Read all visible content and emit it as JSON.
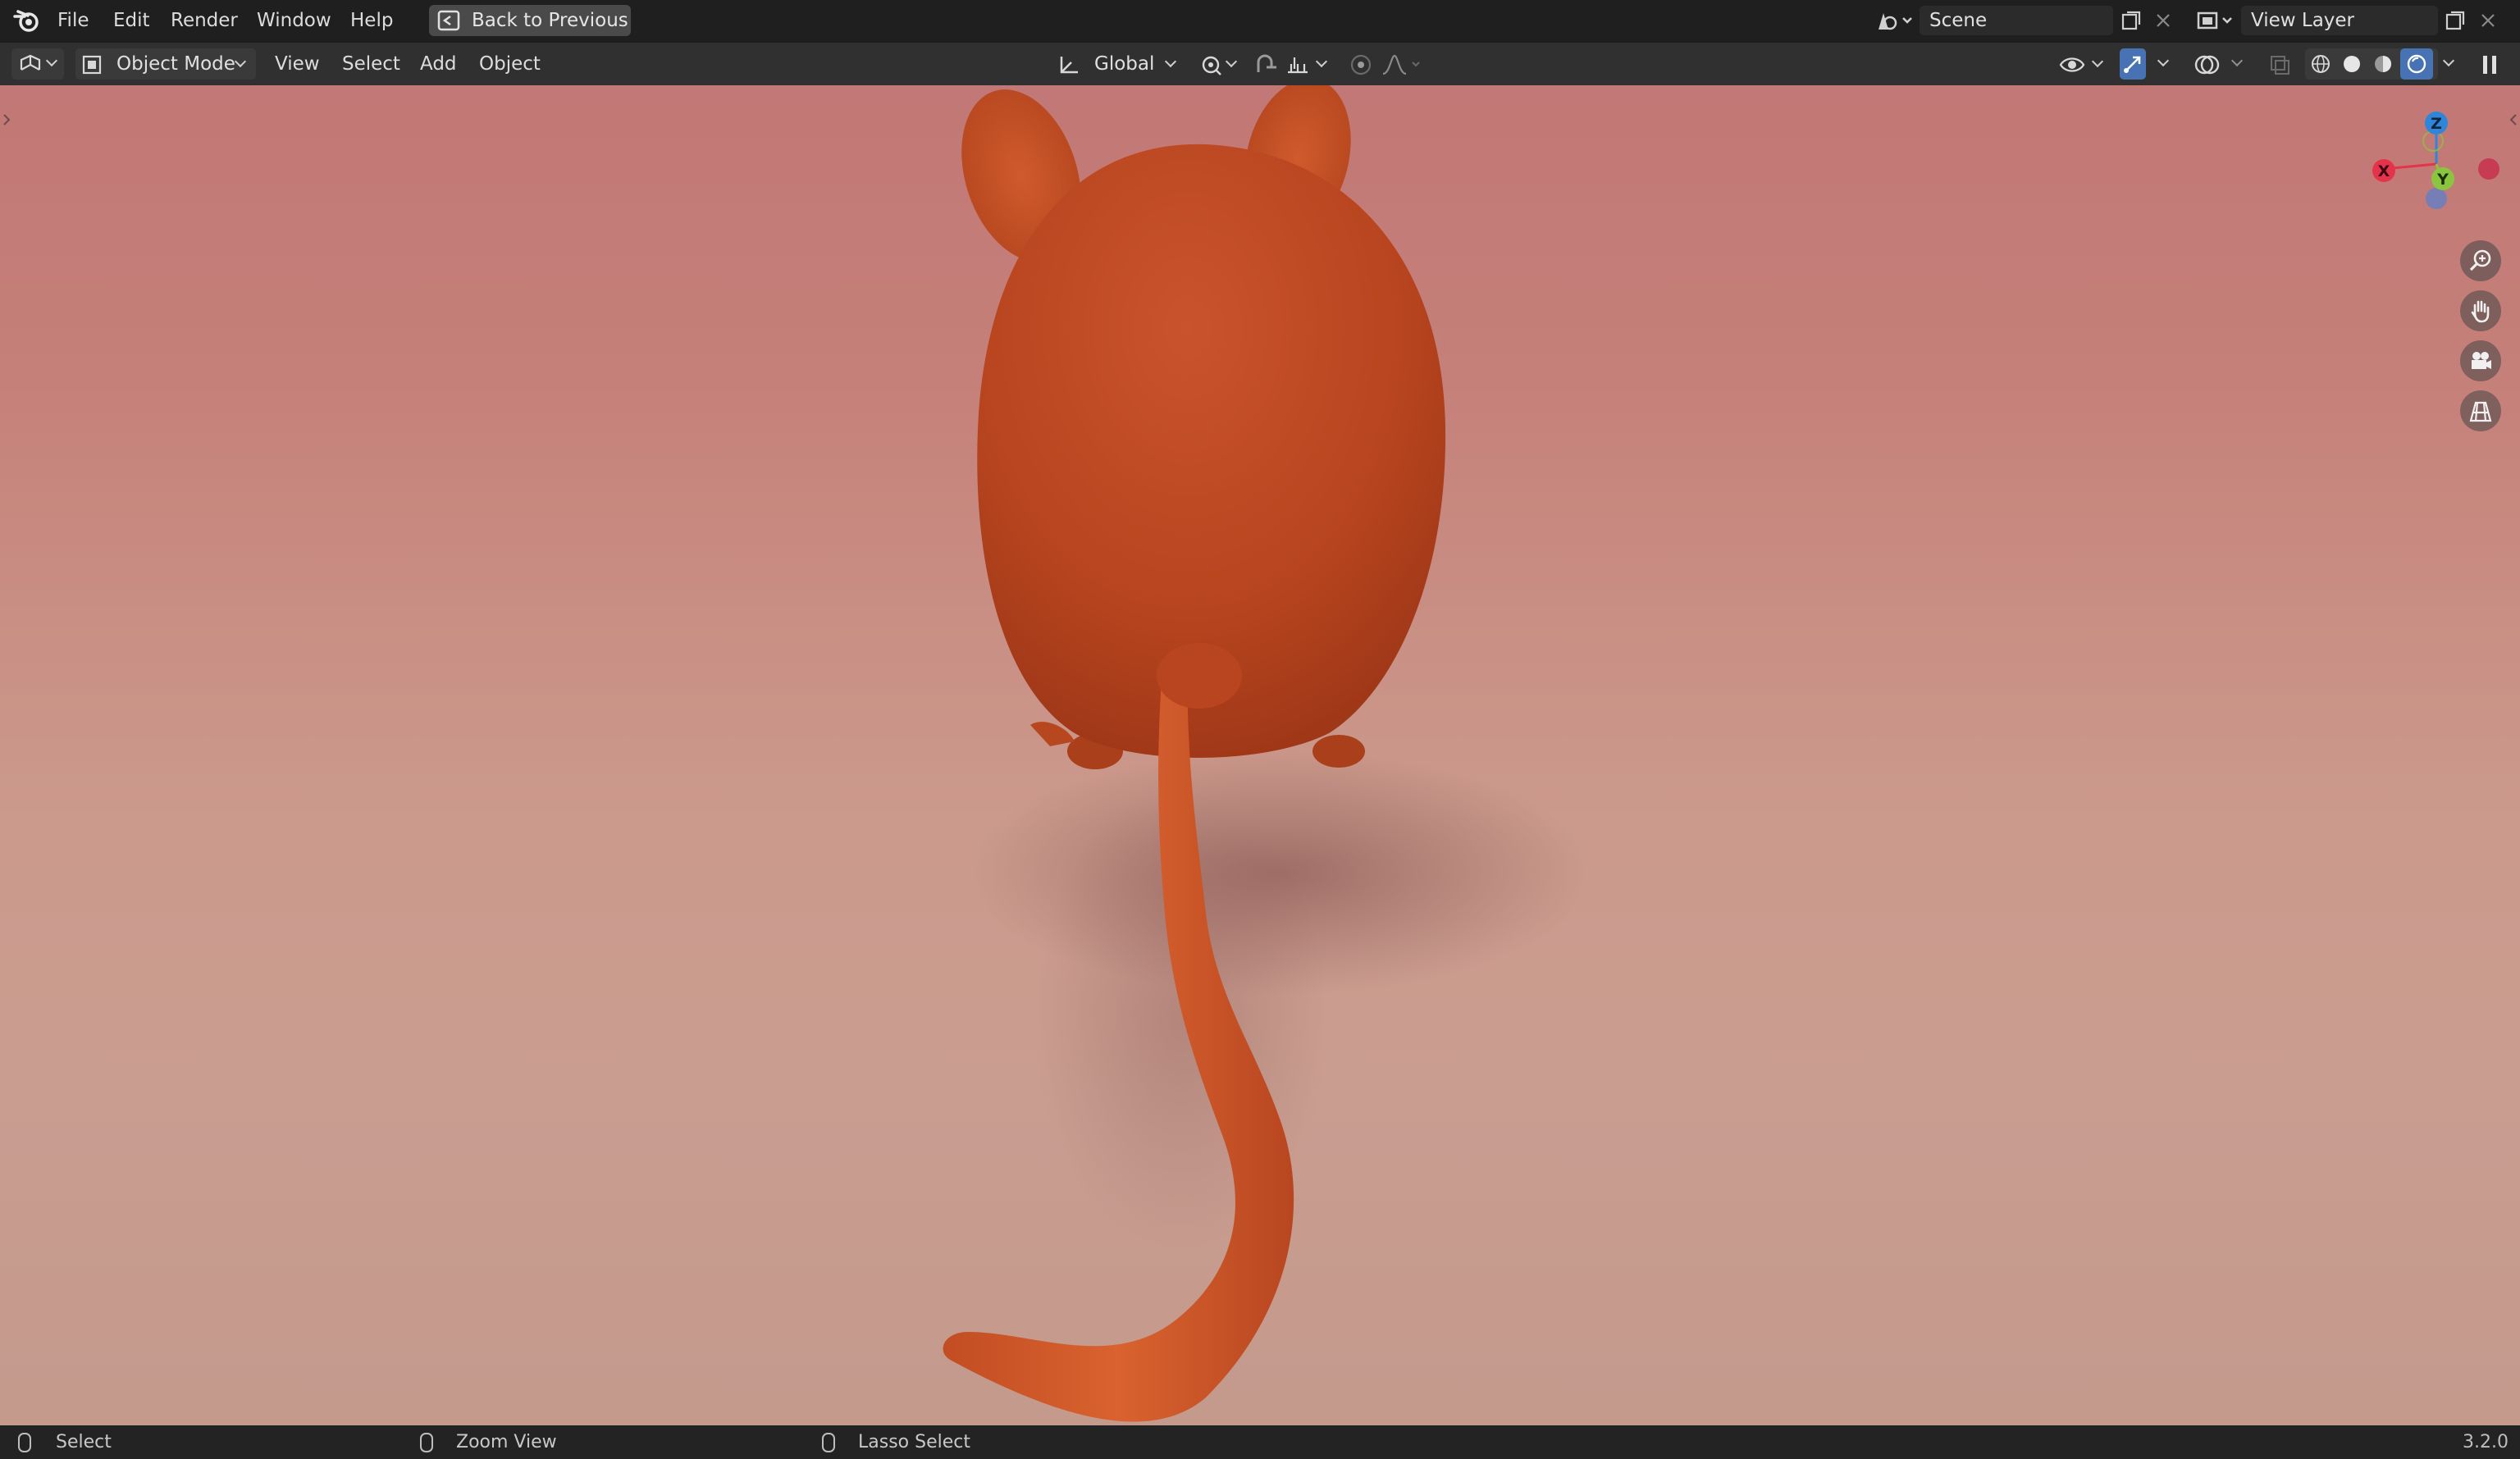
{
  "top_menu": {
    "items": [
      "File",
      "Edit",
      "Render",
      "Window",
      "Help"
    ],
    "back_button": "Back to Previous",
    "scene_name": "Scene",
    "view_layer_name": "View Layer"
  },
  "header": {
    "mode": "Object Mode",
    "menus": [
      "View",
      "Select",
      "Add",
      "Object"
    ],
    "transform_orientation": "Global"
  },
  "gizmo": {
    "z_label": "Z",
    "x_label": "X",
    "y_label": "Y",
    "colors": {
      "x": "#e5334c",
      "y": "#8bc53f",
      "z": "#2f86d9"
    }
  },
  "statusbar": {
    "items": [
      "Select",
      "Zoom View",
      "Lasso Select"
    ],
    "version": "3.2.0"
  },
  "icons": {
    "logo": "blender-logo-icon",
    "editor_type": "3d-viewport-icon",
    "zoom": "zoom-icon",
    "pan": "hand-pan-icon",
    "camera": "camera-view-icon",
    "ortho": "orthographic-grid-icon"
  },
  "colors": {
    "accent_active": "#4772b3",
    "mouse_body": "#d24d1c",
    "floor_top": "#c27876",
    "floor_bottom": "#c49a8d"
  }
}
